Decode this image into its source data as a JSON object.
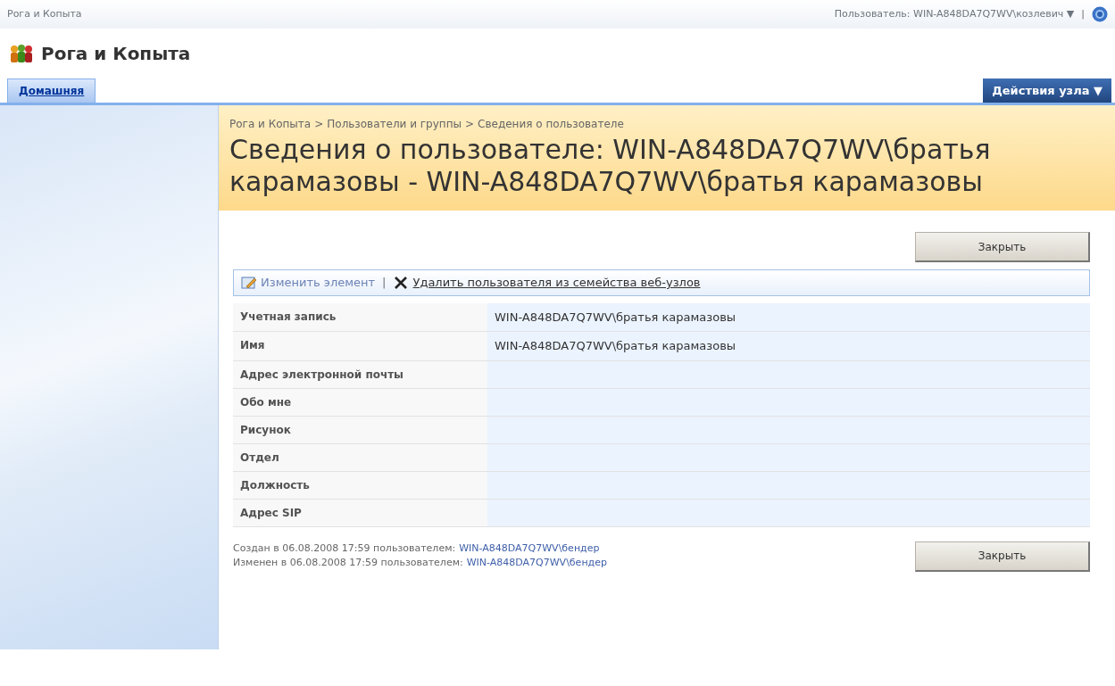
{
  "top_bar": {
    "site": "Рога и Копыта",
    "user": "Пользователь: WIN-A848DA7Q7WV\\козлевич",
    "user_caret": "▼",
    "separator": "|"
  },
  "site_title": "Рога и Копыта",
  "tabs": [
    {
      "label": "Домашняя",
      "selected": true
    }
  ],
  "site_actions": {
    "label": "Действия узла",
    "caret": "▼"
  },
  "breadcrumb": [
    "Рога и Копыта",
    "Пользователи и группы",
    "Сведения о пользователе"
  ],
  "breadcrumb_separator": ">",
  "page_title": "Сведения о пользователе: WIN-A848DA7Q7WV\\братья карамазовы - WIN-A848DA7Q7WV\\братья карамазовы",
  "close_button": "Закрыть",
  "toolbar_separator": "|",
  "toolbar": [
    {
      "kind": "edit",
      "label": "Изменить элемент"
    },
    {
      "kind": "delete",
      "label": "Удалить пользователя из семейства веб-узлов"
    }
  ],
  "fields": [
    {
      "label": "Учетная запись",
      "value": "WIN-A848DA7Q7WV\\братья карамазовы"
    },
    {
      "label": "Имя",
      "value": "WIN-A848DA7Q7WV\\братья карамазовы"
    },
    {
      "label": "Адрес электронной почты"
    },
    {
      "label": "Обо мне"
    },
    {
      "label": "Рисунок"
    },
    {
      "label": "Отдел"
    },
    {
      "label": "Должность"
    },
    {
      "label": "Адрес SIP"
    }
  ],
  "footer": [
    {
      "text": "Создан в 06.08.2008 17:59  пользователем:",
      "user": "WIN-A848DA7Q7WV\\бендер"
    },
    {
      "text": "Изменен в 06.08.2008 17:59  пользователем:",
      "user": "WIN-A848DA7Q7WV\\бендер"
    }
  ],
  "footer_close_button": "Закрыть"
}
